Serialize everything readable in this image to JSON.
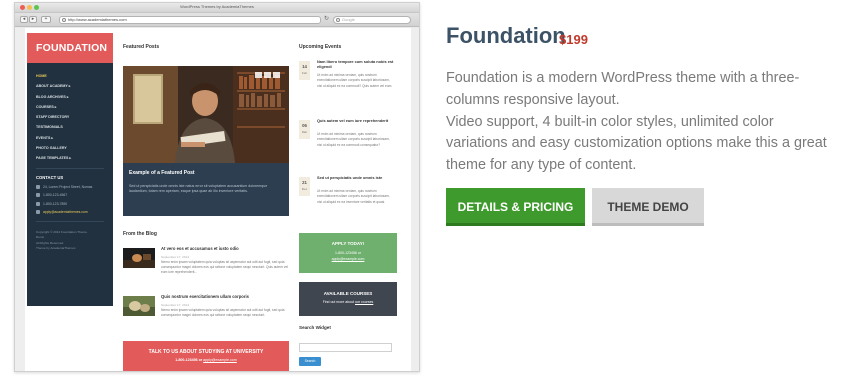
{
  "browser": {
    "window_title": "WordPress Themes by AcademiaThemes",
    "url": "http://www.academiathemes.com",
    "search_placeholder": "Google"
  },
  "site": {
    "logo": "FOUNDATION",
    "menu": [
      {
        "label": "HOME",
        "active": true
      },
      {
        "label": "ABOUT ACADEMY ▸",
        "active": false
      },
      {
        "label": "BLOG ARCHIVES ▸",
        "active": false
      },
      {
        "label": "COURSES ▸",
        "active": false
      },
      {
        "label": "STAFF DIRECTORY",
        "active": false
      },
      {
        "label": "TESTIMONIALS",
        "active": false
      },
      {
        "label": "EVENTS ▸",
        "active": false
      },
      {
        "label": "PHOTO GALLERY",
        "active": false
      },
      {
        "label": "PAGE TEMPLATES ▸",
        "active": false
      }
    ],
    "contact": {
      "heading": "CONTACT US",
      "address": "24, Lorem Project Street, Nomas",
      "phone": "1-800-123-4567",
      "fax": "1-800-123-7890",
      "email": "apply@academiathemes.com"
    },
    "copyright": [
      "Copyright © 2014 Foundation Theme.",
      "Demo",
      "All Rights Reserved.",
      "Theme by AcademiaThemes"
    ],
    "featured": {
      "heading": "Featured Posts",
      "title": "Example of a Featured Post",
      "text": "Sed ut perspiciatis unde omnis iste natus error sit voluptatem accusantium doloremque laudantium, totam rem aperiam, eaque ipsa quae ab illo inventore veritatis."
    },
    "blog": {
      "heading": "From the Blog",
      "posts": [
        {
          "title": "At vero eos et accusamus et iusto odio",
          "date": "September 17, 2014",
          "text": "Nemo enim ipsam voluptatem quia voluptas sit aspernatur aut odit aut fugit, sed quia consequuntur magni dolores eos qui ratione voluptatem sequi nesciunt. Quis autem vel eum iure reprehenderit..."
        },
        {
          "title": "Quis nostrum exercitationem ullam corporis",
          "date": "September 17, 2014",
          "text": "Nemo enim ipsam voluptatem quia voluptas sit aspernatur aut odit aut fugit, sed quia consequuntur magni dolores eos qui ratione voluptatem sequi nesciunt."
        }
      ]
    },
    "talk": {
      "title": "TALK TO US ABOUT STUDYING AT UNIVERSITY",
      "phone": "1-800-123456 or",
      "email": "apply@example.com"
    },
    "events": {
      "heading": "Upcoming Events",
      "items": [
        {
          "day": "14",
          "month": "Feb",
          "title": "Nam libero tempore cum soluta nobis est eligendi",
          "text": "Ut enim ad minima veniam, quis nostrum exercitationem ullam corporis suscipit laboriosam, nisi ut aliquid ex ea commodi? Quis autem vel eum."
        },
        {
          "day": "06",
          "month": "Mar",
          "title": "Quis autem vel eum iure reprehenderit",
          "text": "Ut enim ad minima veniam, quis nostrum exercitationem ullam corporis suscipit laboriosam, nisi ut aliquid ex ea commodi consequatur?"
        },
        {
          "day": "21",
          "month": "Dec",
          "title": "Sed ut perspiciatis unde omnis iste",
          "text": "Ut enim ad minima veniam, quis nostrum exercitationem ullam corporis suscipit laboriosam, nisi ut aliquid ex ea inventore veritatis et quasi."
        }
      ]
    },
    "apply": {
      "title": "APPLY TODAY!",
      "phone": "1-800-123456 or",
      "email": "apply@example.com"
    },
    "courses": {
      "title": "AVAILABLE COURSES",
      "text": "Find out more about",
      "link": "our courses"
    },
    "search_widget": {
      "title": "Search Widget",
      "button": "Search"
    }
  },
  "product": {
    "name": "Foundation",
    "price": "$199",
    "description": [
      "Foundation is a modern WordPress theme with a three-columns responsive layout.",
      "Video support, 4 built-in color styles, unlimited color variations and easy customization options make this a great theme for any type of content."
    ],
    "details_button": "DETAILS & PRICING",
    "demo_button": "THEME DEMO"
  },
  "colors": {
    "accent_red": "#e25a5a",
    "sidebar_navy": "#21313f",
    "apply_green": "#6fb06f",
    "details_green": "#3f9a2d",
    "price_red": "#c0392b"
  }
}
